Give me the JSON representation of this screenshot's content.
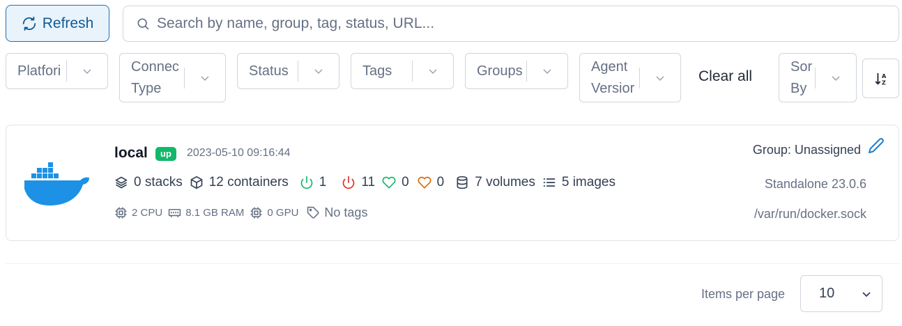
{
  "toolbar": {
    "refresh_label": "Refresh",
    "search_placeholder": "Search by name, group, tag, status, URL..."
  },
  "filters": [
    {
      "line1": "Platfori",
      "line2": ""
    },
    {
      "line1": "Connec",
      "line2": "Type"
    },
    {
      "line1": "Status",
      "line2": ""
    },
    {
      "line1": "Tags",
      "line2": ""
    },
    {
      "line1": "Groups",
      "line2": ""
    },
    {
      "line1": "Agent",
      "line2": "Versior"
    },
    {
      "line1": "Sor",
      "line2": "By"
    }
  ],
  "clear_all_label": "Clear all",
  "environment": {
    "name": "local",
    "status": "up",
    "timestamp": "2023-05-10 09:16:44",
    "stacks": "0 stacks",
    "containers": "12 containers",
    "running": "1",
    "stopped": "11",
    "healthy": "0",
    "unhealthy": "0",
    "volumes": "7 volumes",
    "images": "5 images",
    "cpu": "2 CPU",
    "ram": "8.1 GB RAM",
    "gpu": "0 GPU",
    "tags": "No tags",
    "group": "Group: Unassigned",
    "engine": "Standalone 23.0.6",
    "url": "/var/run/docker.sock"
  },
  "pagination": {
    "items_per_page_label": "Items per page",
    "items_per_page_value": "10"
  },
  "colors": {
    "accent": "#115a92",
    "status_up": "#12b76a",
    "running": "#12b76a",
    "stopped": "#d92d20",
    "healthy": "#12b76a",
    "unhealthy": "#dc6803",
    "docker_blue": "#1d91e6"
  }
}
